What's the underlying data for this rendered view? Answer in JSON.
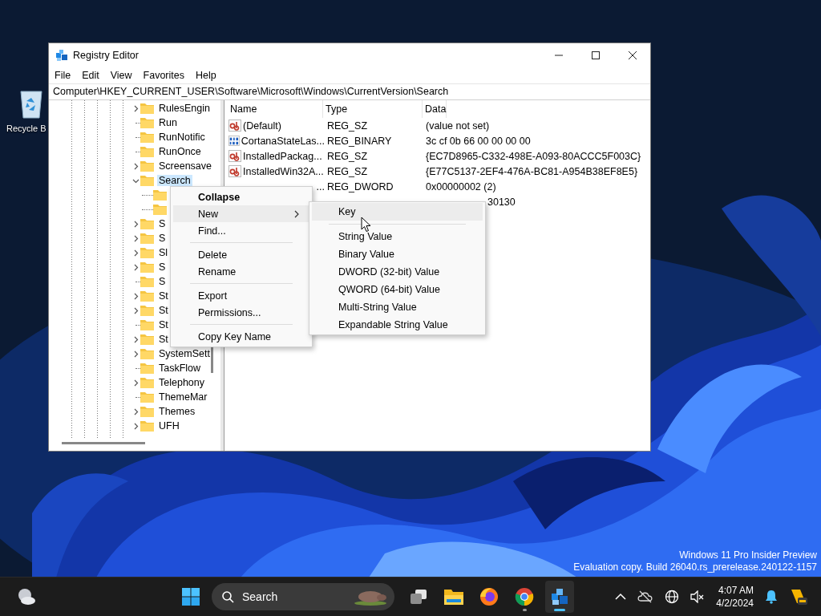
{
  "desktop": {
    "icons": [
      {
        "label": "Recycle B"
      }
    ],
    "watermark": [
      "Windows 11 Pro Insider Preview",
      "Evaluation copy. Build 26040.rs_prerelease.240122-1157"
    ]
  },
  "window": {
    "title": "Registry Editor",
    "menu": [
      "File",
      "Edit",
      "View",
      "Favorites",
      "Help"
    ],
    "address": "Computer\\HKEY_CURRENT_USER\\Software\\Microsoft\\Windows\\CurrentVersion\\Search",
    "tree": [
      {
        "label": "RulesEngin",
        "expandable": true,
        "expanded": false,
        "selected": false
      },
      {
        "label": "Run",
        "expandable": false,
        "expanded": false,
        "selected": false
      },
      {
        "label": "RunNotific",
        "expandable": false,
        "expanded": false,
        "selected": false
      },
      {
        "label": "RunOnce",
        "expandable": false,
        "expanded": false,
        "selected": false
      },
      {
        "label": "Screensave",
        "expandable": true,
        "expanded": false,
        "selected": false
      },
      {
        "label": "Search",
        "expandable": true,
        "expanded": true,
        "selected": true,
        "children": [
          {
            "kind": "folder"
          },
          {
            "kind": "folder"
          }
        ]
      },
      {
        "label": "S",
        "expandable": true,
        "expanded": false,
        "selected": false
      },
      {
        "label": "S",
        "expandable": true,
        "expanded": false,
        "selected": false
      },
      {
        "label": "Sl",
        "expandable": true,
        "expanded": false,
        "selected": false
      },
      {
        "label": "S",
        "expandable": true,
        "expanded": false,
        "selected": false
      },
      {
        "label": "S",
        "expandable": false,
        "expanded": false,
        "selected": false
      },
      {
        "label": "St",
        "expandable": true,
        "expanded": false,
        "selected": false
      },
      {
        "label": "St",
        "expandable": true,
        "expanded": false,
        "selected": false
      },
      {
        "label": "St",
        "expandable": false,
        "expanded": false,
        "selected": false
      },
      {
        "label": "St",
        "expandable": true,
        "expanded": false,
        "selected": false
      },
      {
        "label": "SystemSett",
        "expandable": true,
        "expanded": false,
        "selected": false
      },
      {
        "label": "TaskFlow",
        "expandable": false,
        "expanded": false,
        "selected": false
      },
      {
        "label": "Telephony",
        "expandable": true,
        "expanded": false,
        "selected": false
      },
      {
        "label": "ThemeMar",
        "expandable": false,
        "expanded": false,
        "selected": false
      },
      {
        "label": "Themes",
        "expandable": true,
        "expanded": false,
        "selected": false
      },
      {
        "label": "UFH",
        "expandable": true,
        "expanded": false,
        "selected": false
      }
    ],
    "columns": [
      "Name",
      "Type",
      "Data"
    ],
    "rows": [
      {
        "kind": "string",
        "name": "(Default)",
        "type": "REG_SZ",
        "data": "(value not set)"
      },
      {
        "kind": "binary",
        "name": "CortanaStateLas...",
        "type": "REG_BINARY",
        "data": "3c cf 0b 66 00 00 00 00"
      },
      {
        "kind": "string",
        "name": "InstalledPackag...",
        "type": "REG_SZ",
        "data": "{EC7D8965-C332-498E-A093-80ACCC5F003C}"
      },
      {
        "kind": "string",
        "name": "InstalledWin32A...",
        "type": "REG_SZ",
        "data": "{E77C5137-2EF4-476A-BC81-A954B38EF8E5}"
      },
      {
        "kind": "hidden",
        "name": "...",
        "type": "REG_DWORD",
        "data": "0x00000002 (2)"
      },
      {
        "kind": "tail",
        "data": "30130"
      }
    ]
  },
  "context_menu": {
    "items": [
      {
        "kind": "item",
        "label": "Collapse",
        "bold": true,
        "selected": false
      },
      {
        "kind": "submenu",
        "label": "New",
        "bold": false,
        "selected": true
      },
      {
        "kind": "item",
        "label": "Find...",
        "bold": false,
        "selected": false
      },
      {
        "kind": "separator"
      },
      {
        "kind": "item",
        "label": "Delete",
        "bold": false,
        "selected": false
      },
      {
        "kind": "item",
        "label": "Rename",
        "bold": false,
        "selected": false
      },
      {
        "kind": "separator"
      },
      {
        "kind": "item",
        "label": "Export",
        "bold": false,
        "selected": false
      },
      {
        "kind": "item",
        "label": "Permissions...",
        "bold": false,
        "selected": false
      },
      {
        "kind": "separator"
      },
      {
        "kind": "item",
        "label": "Copy Key Name",
        "bold": false,
        "selected": false
      }
    ]
  },
  "submenu": {
    "items": [
      {
        "kind": "item",
        "label": "Key",
        "selected": true
      },
      {
        "kind": "separator"
      },
      {
        "kind": "item",
        "label": "String Value",
        "selected": false
      },
      {
        "kind": "item",
        "label": "Binary Value",
        "selected": false
      },
      {
        "kind": "item",
        "label": "DWORD (32-bit) Value",
        "selected": false
      },
      {
        "kind": "item",
        "label": "QWORD (64-bit) Value",
        "selected": false
      },
      {
        "kind": "item",
        "label": "Multi-String Value",
        "selected": false
      },
      {
        "kind": "item",
        "label": "Expandable String Value",
        "selected": false
      }
    ]
  },
  "taskbar": {
    "search": {
      "placeholder": "Search"
    },
    "apps": [
      {
        "kind": "taskview",
        "running": false,
        "active": false
      },
      {
        "kind": "explorer",
        "running": false,
        "active": false
      },
      {
        "kind": "firefox",
        "running": false,
        "active": false
      },
      {
        "kind": "chrome",
        "running": true,
        "active": false
      },
      {
        "kind": "regedit",
        "running": true,
        "active": true
      }
    ],
    "time": "4:07 AM",
    "date": "4/2/2024"
  }
}
